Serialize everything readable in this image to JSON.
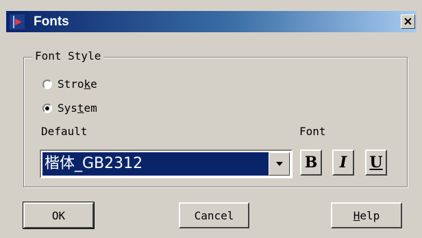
{
  "dialog": {
    "title": "Fonts",
    "close_glyph": "✕",
    "icon": "app-logo-icon"
  },
  "font_style": {
    "group_label": "Font Style",
    "options": [
      {
        "pre": "Stro",
        "accel": "k",
        "post": "e",
        "checked": false
      },
      {
        "pre": "Sys",
        "accel": "t",
        "post": "em",
        "checked": true
      }
    ]
  },
  "default": {
    "label": "Default",
    "combo_value": "楷体_GB2312"
  },
  "font": {
    "label": "Font",
    "bold": "B",
    "italic": "I",
    "underline": "U"
  },
  "buttons": {
    "ok": "OK",
    "cancel": "Cancel",
    "help_accel": "H",
    "help_rest": "elp"
  },
  "colors": {
    "face": "#d4d0c8",
    "title_start": "#0a246a",
    "title_end": "#a6caf0",
    "selection": "#0a246a"
  }
}
